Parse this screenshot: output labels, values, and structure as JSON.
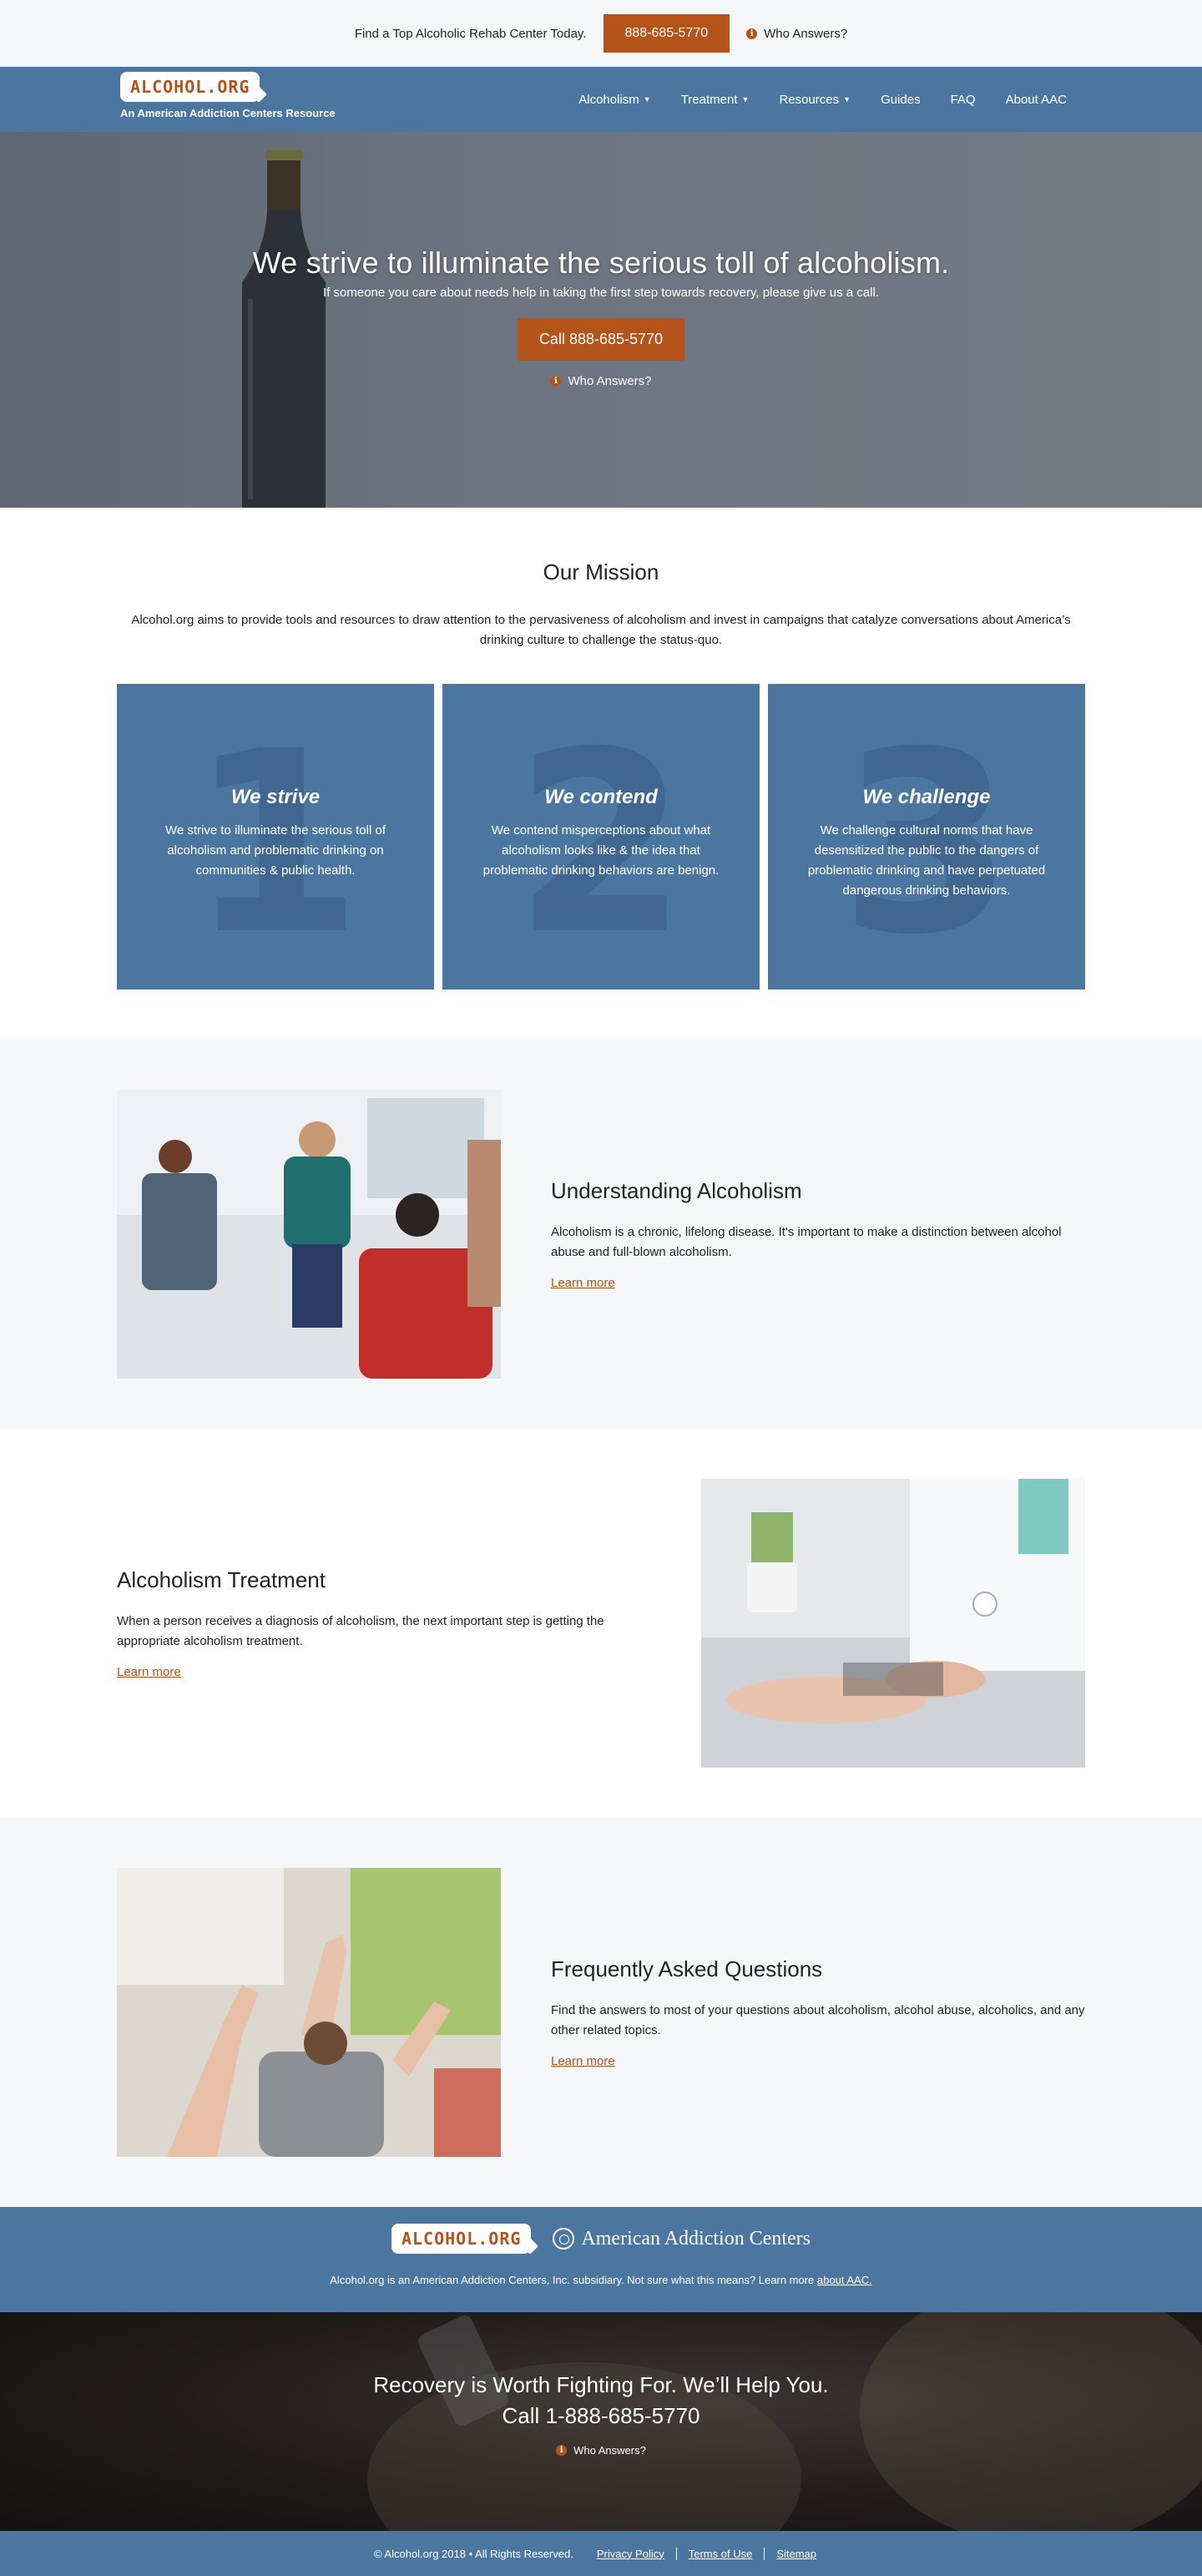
{
  "topbar": {
    "text": "Find a Top Alcoholic Rehab Center Today.",
    "phone": "888-685-5770",
    "who_answers": "Who Answers?"
  },
  "nav": {
    "logo": "ALCOHOL.ORG",
    "tagline": "An American Addiction Centers Resource",
    "items": [
      {
        "label": "Alcoholism",
        "dropdown": true
      },
      {
        "label": "Treatment",
        "dropdown": true
      },
      {
        "label": "Resources",
        "dropdown": true
      },
      {
        "label": "Guides",
        "dropdown": false
      },
      {
        "label": "FAQ",
        "dropdown": false
      },
      {
        "label": "About AAC",
        "dropdown": false
      }
    ]
  },
  "hero": {
    "title": "We strive to illuminate the serious toll of alcoholism.",
    "subtitle": "If someone you care about needs help in taking the first step towards recovery, please give us a call.",
    "call_label": "Call 888-685-5770",
    "who_answers": "Who Answers?"
  },
  "mission": {
    "title": "Our Mission",
    "text": "Alcohol.org aims to provide tools and resources to draw attention to the pervasiveness of alcoholism and invest in campaigns that catalyze conversations about America’s drinking culture to challenge the status-quo.",
    "cards": [
      {
        "number": "1",
        "title": "We strive",
        "text": "We strive to illuminate the serious toll of alcoholism and problematic drinking on communities & public health."
      },
      {
        "number": "2",
        "title": "We contend",
        "text": "We contend misperceptions about what alcoholism looks like & the idea that problematic drinking behaviors are benign."
      },
      {
        "number": "3",
        "title": "We challenge",
        "text": "We challenge cultural norms that have desensitized the public to the dangers of problematic drinking and have perpetuated dangerous drinking behaviors."
      }
    ]
  },
  "features": [
    {
      "title": "Understanding Alcoholism",
      "text": "Alcoholism is a chronic, lifelong disease. It's important to make a distinction between alcohol abuse and full-blown alcoholism.",
      "link": "Learn more"
    },
    {
      "title": "Alcoholism Treatment",
      "text": "When a person receives a diagnosis of alcoholism, the next important step is getting the appropriate alcoholism treatment.",
      "link": "Learn more"
    },
    {
      "title": "Frequently Asked Questions",
      "text": "Find the answers to most of your questions about alcoholism, alcohol abuse, alcoholics, and any other related topics.",
      "link": "Learn more"
    }
  ],
  "footer": {
    "logo": "ALCOHOL.ORG",
    "aac_name": "American Addiction Centers",
    "subsidiary_text": "Alcohol.org is an American Addiction Centers, Inc. subsidiary. Not sure what this means? Learn more",
    "about_link": "about AAC.",
    "cta_title": "Recovery is Worth Fighting For. We’ll Help You.",
    "cta_phone": "Call 1-888-685-5770",
    "who_answers": "Who Answers?",
    "copyright": "© Alcohol.org 2018 • All Rights Reserved.",
    "links": [
      "Privacy Policy",
      "Terms of Use",
      "Sitemap"
    ]
  },
  "colors": {
    "accent": "#b4531a",
    "brand_blue": "#4b76a0",
    "light_gray": "#f5f6f8"
  }
}
